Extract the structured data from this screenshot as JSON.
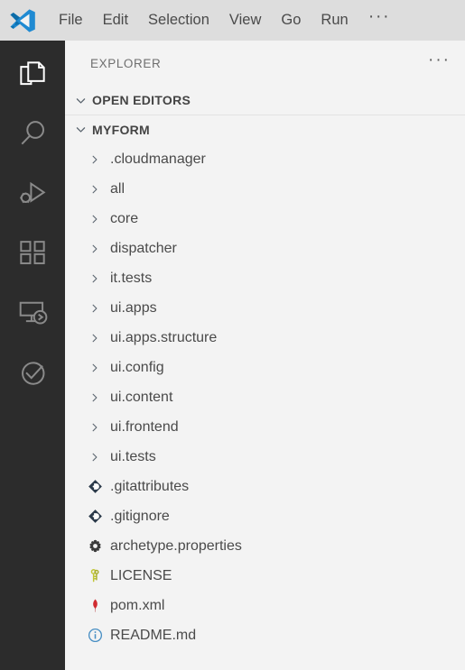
{
  "window": {
    "logo": "vscode-logo",
    "menubar_bg": "#dddddd",
    "activitybar_bg": "#2c2c2c",
    "sidebar_bg": "#f3f3f3"
  },
  "menubar": {
    "items": [
      {
        "label": "File"
      },
      {
        "label": "Edit"
      },
      {
        "label": "Selection"
      },
      {
        "label": "View"
      },
      {
        "label": "Go"
      },
      {
        "label": "Run"
      },
      {
        "label": "···"
      }
    ]
  },
  "activitybar": {
    "items": [
      {
        "name": "explorer",
        "icon": "files-icon",
        "active": true
      },
      {
        "name": "search",
        "icon": "search-icon",
        "active": false
      },
      {
        "name": "run-and-debug",
        "icon": "run-debug-icon",
        "active": false
      },
      {
        "name": "extensions",
        "icon": "extensions-icon",
        "active": false
      },
      {
        "name": "remote-explorer",
        "icon": "remote-explorer-icon",
        "active": false
      },
      {
        "name": "testing",
        "icon": "testing-icon",
        "active": false
      }
    ]
  },
  "sidebar": {
    "title": "EXPLORER",
    "title_actions": "···",
    "sections": [
      {
        "label": "OPEN EDITORS",
        "expanded": true
      },
      {
        "label": "MYFORM",
        "expanded": true
      }
    ]
  },
  "tree": {
    "items": [
      {
        "label": ".cloudmanager",
        "type": "folder",
        "icon": "chevron-right-icon",
        "expanded": false
      },
      {
        "label": "all",
        "type": "folder",
        "icon": "chevron-right-icon",
        "expanded": false
      },
      {
        "label": "core",
        "type": "folder",
        "icon": "chevron-right-icon",
        "expanded": false
      },
      {
        "label": "dispatcher",
        "type": "folder",
        "icon": "chevron-right-icon",
        "expanded": false
      },
      {
        "label": "it.tests",
        "type": "folder",
        "icon": "chevron-right-icon",
        "expanded": false
      },
      {
        "label": "ui.apps",
        "type": "folder",
        "icon": "chevron-right-icon",
        "expanded": false
      },
      {
        "label": "ui.apps.structure",
        "type": "folder",
        "icon": "chevron-right-icon",
        "expanded": false
      },
      {
        "label": "ui.config",
        "type": "folder",
        "icon": "chevron-right-icon",
        "expanded": false
      },
      {
        "label": "ui.content",
        "type": "folder",
        "icon": "chevron-right-icon",
        "expanded": false
      },
      {
        "label": "ui.frontend",
        "type": "folder",
        "icon": "chevron-right-icon",
        "expanded": false
      },
      {
        "label": "ui.tests",
        "type": "folder",
        "icon": "chevron-right-icon",
        "expanded": false
      },
      {
        "label": ".gitattributes",
        "type": "file",
        "icon": "git-icon"
      },
      {
        "label": ".gitignore",
        "type": "file",
        "icon": "git-icon"
      },
      {
        "label": "archetype.properties",
        "type": "file",
        "icon": "gear-icon"
      },
      {
        "label": "LICENSE",
        "type": "file",
        "icon": "key-icon"
      },
      {
        "label": "pom.xml",
        "type": "file",
        "icon": "maven-feather-icon"
      },
      {
        "label": "README.md",
        "type": "file",
        "icon": "info-circle-icon"
      }
    ]
  },
  "colors": {
    "git_icon": "#2b3a4a",
    "git_icon_accent": "#f05133",
    "gear_icon": "#3b3b3b",
    "key_icon": "#c0c537",
    "maven_icon": "#d02a30",
    "info_icon": "#4a90c4",
    "text": "#4a4a4a",
    "section_text": "#444444",
    "title_text": "#6f6f6f",
    "arrow": "#5c6670"
  }
}
